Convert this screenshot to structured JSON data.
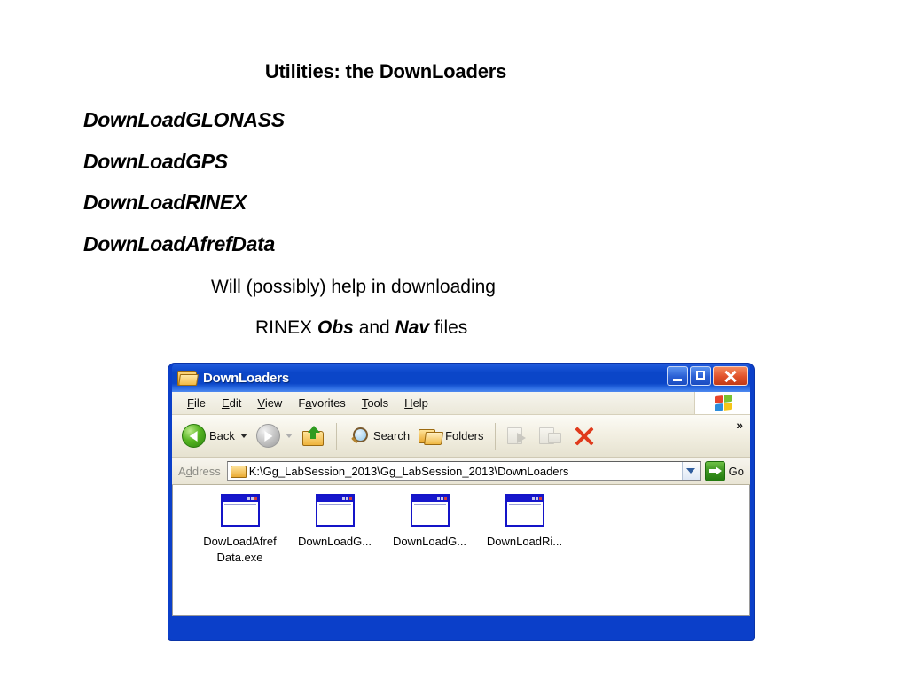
{
  "slide": {
    "title": "Utilities: the DownLoaders",
    "utilities": [
      "DownLoadGLONASS",
      "DownLoadGPS",
      "DownLoadRINEX",
      "DownLoadAfrefData"
    ],
    "note_line_1": "Will (possibly) help in downloading",
    "note_line_2_pre": "RINEX ",
    "note_line_2_bold_1": "Obs",
    "note_line_2_mid": " and ",
    "note_line_2_bold_2": "Nav",
    "note_line_2_post": " files"
  },
  "explorer": {
    "title": "DownLoaders",
    "title_icon": "folder-open-icon",
    "caption_buttons": {
      "minimize": "minimize-icon",
      "maximize": "maximize-icon",
      "close": "close-icon"
    },
    "menus": [
      {
        "pre": "",
        "accel": "F",
        "post": "ile"
      },
      {
        "pre": "",
        "accel": "E",
        "post": "dit"
      },
      {
        "pre": "",
        "accel": "V",
        "post": "iew"
      },
      {
        "pre": "F",
        "accel": "a",
        "post": "vorites"
      },
      {
        "pre": "",
        "accel": "T",
        "post": "ools"
      },
      {
        "pre": "",
        "accel": "H",
        "post": "elp"
      }
    ],
    "brand_icon": "windows-flag-icon",
    "toolbar": {
      "back_label": "Back",
      "search_label": "Search",
      "folders_label": "Folders",
      "overflow_label": "»",
      "icons": {
        "back": "back-arrow-icon",
        "forward": "forward-arrow-icon",
        "up": "up-one-level-icon",
        "search": "magnifier-icon",
        "folders": "folders-icon",
        "move_to": "move-to-folder-icon",
        "copy_to": "copy-to-folder-icon",
        "delete": "delete-x-icon"
      }
    },
    "address": {
      "label_pre": "A",
      "label_accel": "d",
      "label_post": "dress",
      "value": "K:\\Gg_LabSession_2013\\Gg_LabSession_2013\\DownLoaders",
      "folder_icon": "folder-icon",
      "dropdown_icon": "chevron-down-icon",
      "go_label": "Go",
      "go_icon": "go-arrow-icon"
    },
    "files": [
      {
        "name": "DowLoadAfref\nData.exe",
        "icon": "executable-icon"
      },
      {
        "name": "DownLoadG...",
        "icon": "executable-icon"
      },
      {
        "name": "DownLoadG...",
        "icon": "executable-icon"
      },
      {
        "name": "DownLoadRi...",
        "icon": "executable-icon"
      }
    ]
  },
  "colors": {
    "title_bar_blue": "#0b46c8",
    "window_border_blue": "#0b3fc9",
    "close_red": "#e0512a",
    "back_green": "#56b521",
    "go_green": "#3f9622",
    "delete_red": "#e03a1c",
    "exe_icon_blue": "#1616cc"
  }
}
